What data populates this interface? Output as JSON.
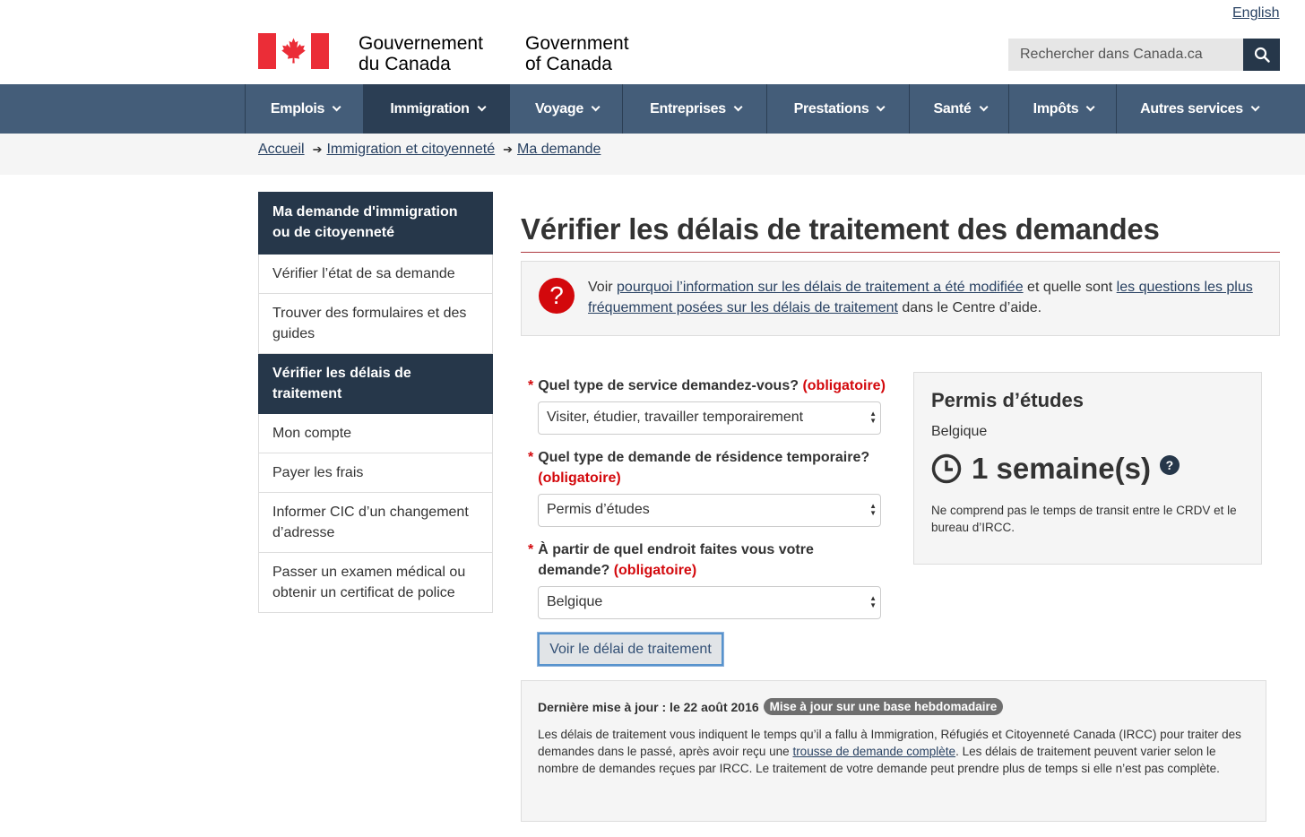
{
  "header": {
    "language_link": "English",
    "fip_fr_line1": "Gouvernement",
    "fip_fr_line2": "du Canada",
    "fip_en_line1": "Government",
    "fip_en_line2": "of Canada",
    "search_placeholder": "Rechercher dans Canada.ca",
    "search_icon": "search-icon"
  },
  "menu": {
    "items": [
      {
        "label": "Emplois"
      },
      {
        "label": "Immigration"
      },
      {
        "label": "Voyage"
      },
      {
        "label": "Entreprises"
      },
      {
        "label": "Prestations"
      },
      {
        "label": "Santé"
      },
      {
        "label": "Impôts"
      },
      {
        "label": "Autres services"
      }
    ],
    "active": "Immigration"
  },
  "breadcrumb": {
    "items": [
      "Accueil",
      "Immigration et citoyenneté",
      "Ma demande"
    ]
  },
  "sidebar": {
    "heading": "Ma demande d'immigration ou de citoyenneté",
    "items": [
      "Vérifier l’état de sa demande",
      "Trouver des formulaires et des guides",
      "Vérifier les délais de traitement",
      "Mon compte",
      "Payer les frais",
      "Informer CIC d’un changement d’adresse",
      "Passer un examen médical ou obtenir un certificat de police"
    ],
    "selected": "Vérifier les délais de traitement"
  },
  "main": {
    "title": "Vérifier les délais de traitement des demandes",
    "alert": {
      "text_1": "Voir ",
      "link_1": "pourquoi l’information sur les délais de traitement a été modifiée",
      "text_2": " et quelle sont ",
      "link_2": "les questions les plus fréquemment posées sur les délais de traitement",
      "text_3": " dans le Centre d’aide.",
      "icon": "?"
    },
    "form": {
      "required_marker": "*",
      "required_text": "(obligatoire)",
      "q1_label": "Quel type de service demandez-vous?",
      "q1_value": "Visiter, étudier, travailler temporairement",
      "q2_label": "Quel type de demande de résidence temporaire?",
      "q2_value": "Permis d’études",
      "q3_label_line1": "À partir de quel endroit faites vous votre",
      "q3_label_line2": "demande?",
      "q3_value": "Belgique",
      "submit_label": "Voir le délai de traitement"
    },
    "result": {
      "title": "Permis d’études",
      "country": "Belgique",
      "time": "1 semaine(s)",
      "help_icon": "?",
      "note": "Ne comprend pas le temps de transit entre le CRDV et le bureau d’IRCC."
    },
    "update": {
      "last_updated": "Dernière mise à jour : le 22 août 2016",
      "badge": "Mise à jour sur une base hebdomadaire",
      "text_1": "Les délais de traitement vous indiquent le temps qu’il a fallu à Immigration, Réfugiés et Citoyenneté Canada (IRCC) pour traiter des demandes dans le passé, après avoir reçu une ",
      "link": "trousse de demande complète",
      "text_2": ". Les délais de traitement peuvent varier selon le nombre de demandes reçues par IRCC. Le traitement de votre demande peut prendre plus de temps si elle n’est pas complète."
    }
  },
  "colors": {
    "nav": "#445d79",
    "nav_active": "#2b3e54",
    "sidebar_selected": "#26374a",
    "required": "#d3080c",
    "flag_red": "#eb2d37",
    "title_rule": "#af3c43"
  }
}
